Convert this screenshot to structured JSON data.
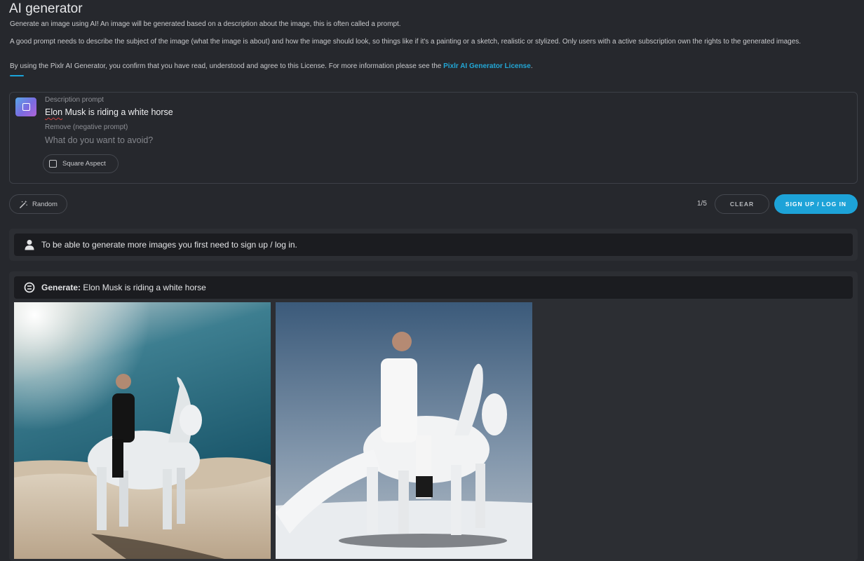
{
  "header": {
    "title": "AI generator",
    "intro_1": "Generate an image using AI! An image will be generated based on a description about the image, this is often called a prompt.",
    "intro_2": "A good prompt needs to describe the subject of the image (what the image is about) and how the image should look, so things like if it's a painting or a sketch, realistic or stylized. Only users with a active subscription own the rights to the generated images.",
    "intro_3_prefix": "By using the Pixlr AI Generator, you confirm that you have read, understood and agree to this License. For more information please see the ",
    "license_link": "Pixlr AI Generator License",
    "intro_3_suffix": "."
  },
  "prompt": {
    "description_label": "Description prompt",
    "description_first_word": "Elon",
    "description_rest": " Musk is riding a white horse",
    "negative_label": "Remove (negative prompt)",
    "negative_value": "",
    "negative_placeholder": "What do you want to avoid?",
    "square_aspect_label": "Square Aspect"
  },
  "actions": {
    "random_label": "Random",
    "count": "1/5",
    "clear_label": "CLEAR",
    "signup_label": "SIGN UP / LOG IN"
  },
  "notice": {
    "text": "To be able to generate more images you first need to sign up / log in."
  },
  "results": {
    "generate_label": "Generate:",
    "generate_prompt": "Elon Musk is riding a white horse"
  },
  "icons": {
    "generator": "square-icon",
    "random": "magic-wand-icon",
    "notice": "user-icon",
    "generate": "ai-badge-icon",
    "square_aspect": "checkbox-icon"
  },
  "colors": {
    "background": "#26282d",
    "accent": "#1da3d8",
    "panel": "#2c2e33",
    "bar": "#1b1c20"
  }
}
